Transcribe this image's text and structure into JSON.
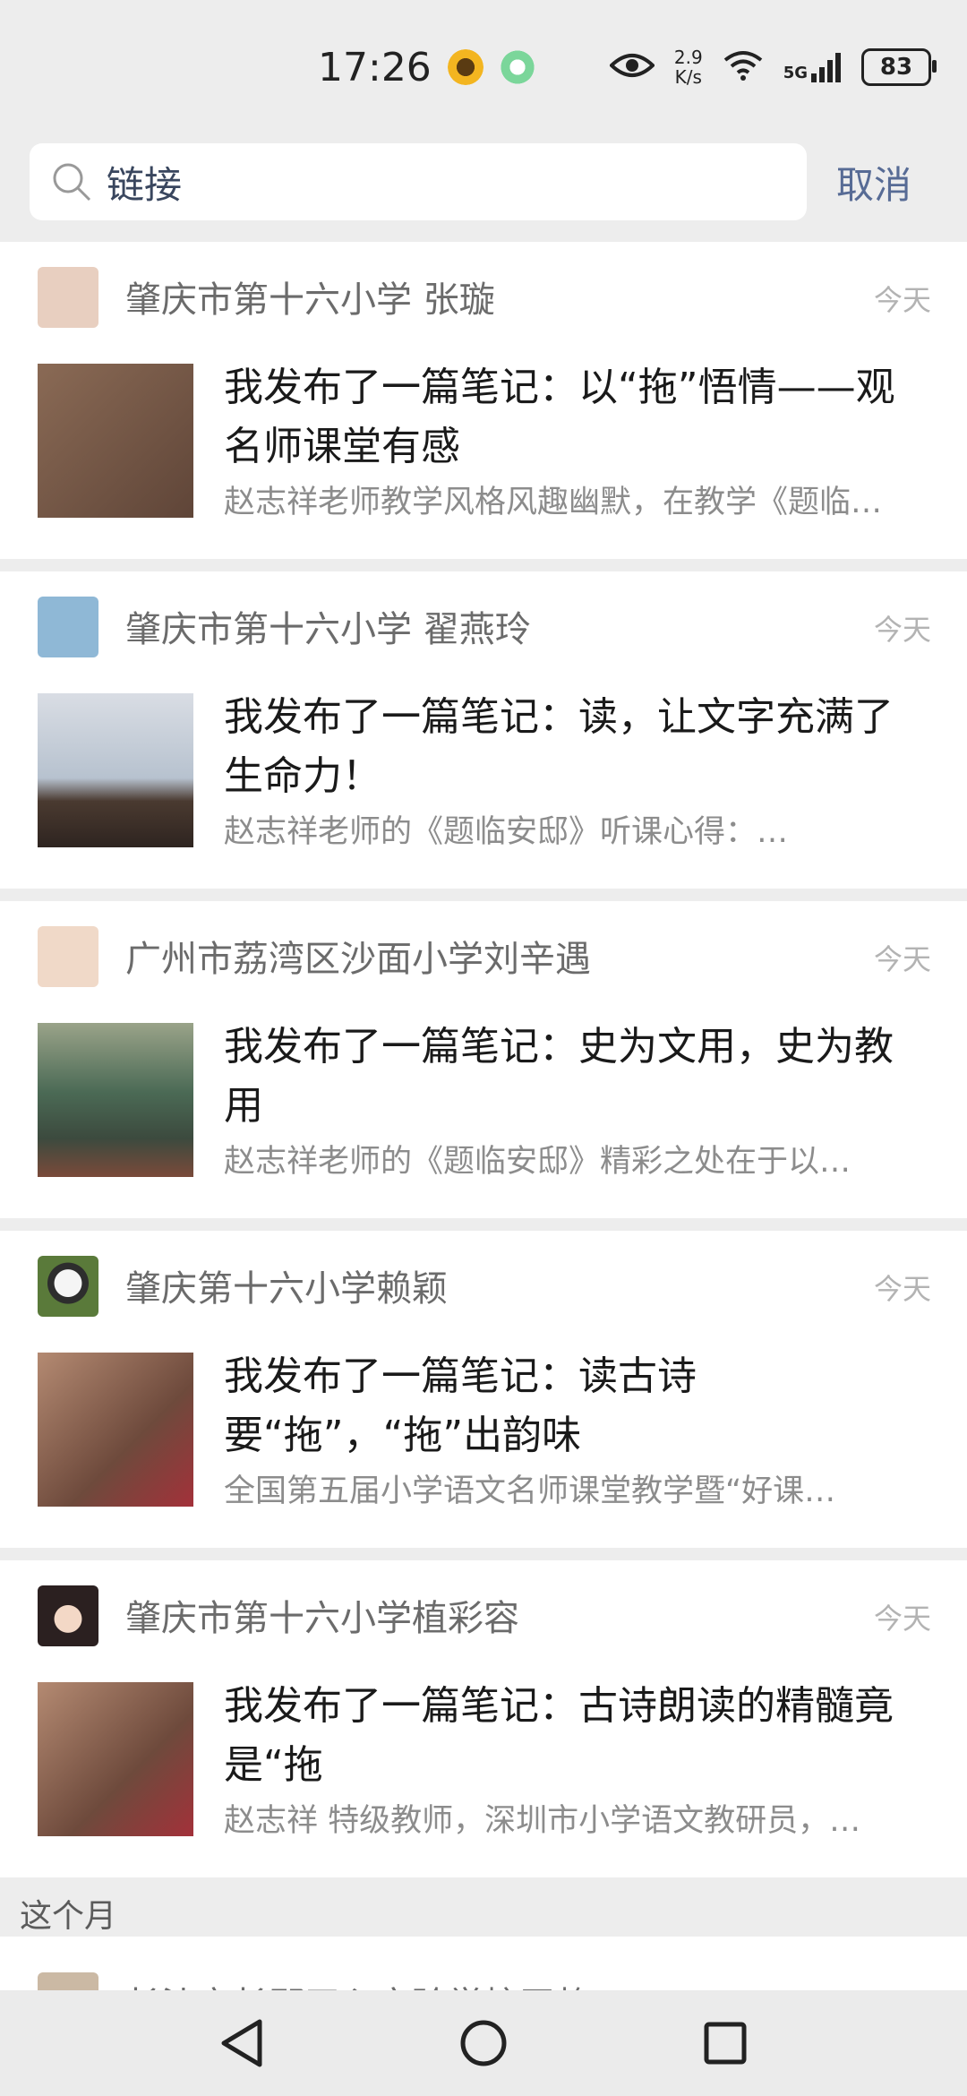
{
  "status": {
    "time": "17:26",
    "net_speed_value": "2.9",
    "net_speed_unit": "K/s",
    "network": "5G",
    "battery": "83"
  },
  "search": {
    "query": "链接",
    "cancel_label": "取消"
  },
  "posts": [
    {
      "author": "肇庆市第十六小学 张璇",
      "date": "今天",
      "title": "我发布了一篇笔记：以“拖”悟情——观名师课堂有感",
      "excerpt": "赵志祥老师教学风格风趣幽默，在教学《题临安邸》…",
      "avatar_color": "#e8cfc0",
      "thumb_color": "#7a5a48"
    },
    {
      "author": "肇庆市第十六小学  翟燕玲",
      "date": "今天",
      "title": "我发布了一篇笔记：读，让文字充满了生命力！",
      "excerpt": "赵志祥老师的《题临安邸》听课心得：…",
      "avatar_color": "#8fb8d6",
      "thumb_color": "#5a6a84"
    },
    {
      "author": "广州市荔湾区沙面小学刘辛遇",
      "date": "今天",
      "title": "我发布了一篇笔记：史为文用，史为教用",
      "excerpt": "赵志祥老师的《题临安邸》精彩之处在于以…",
      "avatar_color": "#f0d9c8",
      "thumb_color": "#5f6e54"
    },
    {
      "author": "肇庆第十六小学赖颖",
      "date": "今天",
      "title": "我发布了一篇笔记：读古诗要“拖”，“拖”出韵味",
      "excerpt": "全国第五届小学语文名师课堂教学暨“好课…",
      "avatar_color": "#3d4a3a",
      "thumb_color": "#8c5e4c"
    },
    {
      "author": "肇庆市第十六小学植彩容",
      "date": "今天",
      "title": "我发布了一篇笔记：古诗朗读的精髓竟是“拖",
      "excerpt": "赵志祥 特级教师，深圳市小学语文教研员，…",
      "avatar_color": "#b08070",
      "thumb_color": "#8a5e4e"
    }
  ],
  "section": {
    "label": "这个月"
  },
  "partial_post": {
    "author": "长沙市长郡天心实验学校王静"
  }
}
